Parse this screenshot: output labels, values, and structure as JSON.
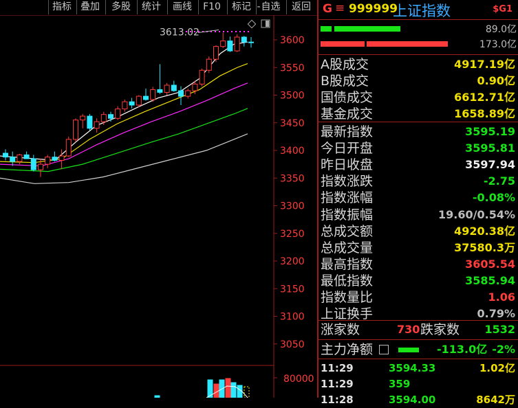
{
  "toolbar": {
    "items": [
      "指标",
      "叠加",
      "多股",
      "统计",
      "画线",
      "F10",
      "标记",
      "自选",
      "返回"
    ],
    "dash": "-"
  },
  "chart": {
    "high_marker": "3613.02",
    "price_ticks": [
      "3600",
      "3550",
      "3500",
      "3450",
      "3400",
      "3350",
      "3300",
      "3250",
      "3200",
      "3150",
      "3100",
      "3050"
    ],
    "volume_tick": "80000",
    "colors": {
      "up": "#ff3c3c",
      "down": "#2ee8ff",
      "ma5": "#ffffff",
      "ma10": "#f0e000",
      "ma20": "#ff28ff",
      "ma30": "#17e317",
      "ma60": "#cfcfcf"
    }
  },
  "panel": {
    "header": {
      "g": "G",
      "menu_icon": "≡",
      "code": "999999",
      "name": "上证指数",
      "tag": "$G1"
    },
    "bars": [
      {
        "value": "89.0亿",
        "color": "#17e317",
        "fraction": 0.33
      },
      {
        "value": "173.0亿",
        "color": "#ff3c3c",
        "fraction": 0.64
      }
    ],
    "turnover": [
      {
        "label": "A股成交",
        "value": "4917.19亿"
      },
      {
        "label": "B股成交",
        "value": "0.90亿"
      },
      {
        "label": "国债成交",
        "value": "6612.71亿"
      },
      {
        "label": "基金成交",
        "value": "1658.89亿"
      }
    ],
    "stats": [
      {
        "label": "最新指数",
        "value": "3595.19",
        "color": "green"
      },
      {
        "label": "今日开盘",
        "value": "3595.81",
        "color": "green"
      },
      {
        "label": "昨日收盘",
        "value": "3597.94",
        "color": "white"
      },
      {
        "label": "指数涨跌",
        "value": "-2.75",
        "color": "green"
      },
      {
        "label": "指数涨幅",
        "value": "-0.08%",
        "color": "green"
      },
      {
        "label": "指数振幅",
        "value": "19.60/0.54%",
        "color": "gray"
      },
      {
        "label": "总成交额",
        "value": "4920.38亿",
        "color": "yellow"
      },
      {
        "label": "总成交量",
        "value": "37580.3万",
        "color": "yellow"
      },
      {
        "label": "最高指数",
        "value": "3605.54",
        "color": "red"
      },
      {
        "label": "最低指数",
        "value": "3585.94",
        "color": "green"
      },
      {
        "label": "指数量比",
        "value": "1.06",
        "color": "red"
      },
      {
        "label": "上证换手",
        "value": "0.79%",
        "color": "gray"
      }
    ],
    "breadth": {
      "up_label": "涨家数",
      "up_value": "730",
      "down_label": "跌家数",
      "down_value": "1532"
    },
    "main_flow": {
      "label": "主力净额",
      "value": "-113.0亿",
      "pct": "-2%"
    },
    "ticks": [
      {
        "time": "11:29",
        "price": "3594.33",
        "vol": "1.02亿"
      },
      {
        "time": "11:29",
        "price": "359",
        "vol": ""
      },
      {
        "time": "11:28",
        "price": "3594.00",
        "vol": "8642万"
      }
    ]
  }
}
